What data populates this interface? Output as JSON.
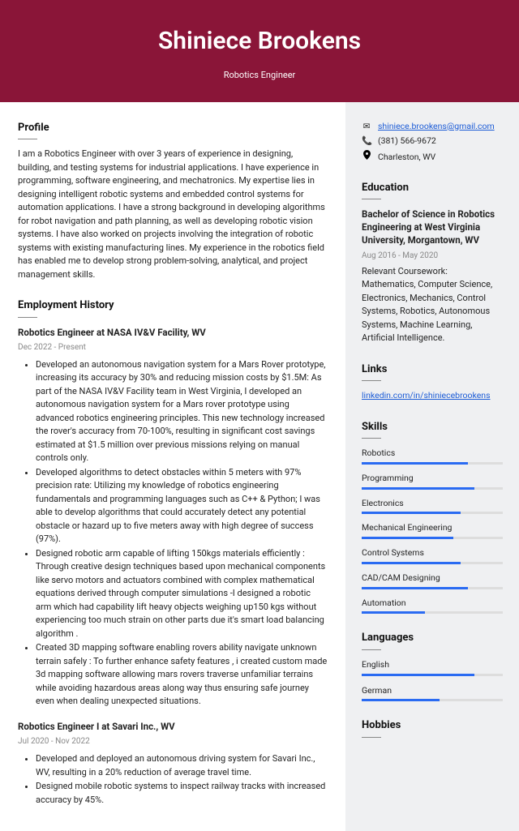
{
  "header": {
    "name": "Shiniece Brookens",
    "title": "Robotics Engineer"
  },
  "sections": {
    "profile": "Profile",
    "employment": "Employment History",
    "education": "Education",
    "links": "Links",
    "skills": "Skills",
    "languages": "Languages",
    "hobbies": "Hobbies"
  },
  "profile_text": "I am a Robotics Engineer with over 3 years of experience in designing, building, and testing systems for industrial applications. I have experience in programming, software engineering, and mechatronics. My expertise lies in designing intelligent robotic systems and embedded control systems for automation applications. I have a strong background in developing algorithms for robot navigation and path planning, as well as developing robotic vision systems. I have also worked on projects involving the integration of robotic systems with existing manufacturing lines. My experience in the robotics field has enabled me to develop strong problem-solving, analytical, and project management skills.",
  "jobs": [
    {
      "title": "Robotics Engineer at NASA IV&V Facility, WV",
      "dates": "Dec 2022 - Present",
      "bullets": [
        "Developed an autonomous navigation system for a Mars Rover prototype, increasing its accuracy by 30% and reducing mission costs by $1.5M: As part of the NASA IV&V Facility team in West Virginia, I developed an autonomous navigation system for a Mars rover prototype using advanced robotics engineering principles. This new technology increased the rover's accuracy from 70-100%, resulting in significant cost savings estimated at $1.5 million over previous missions relying on manual controls only.",
        "Developed algorithms to detect obstacles within 5 meters with 97% precision rate: Utilizing my knowledge of robotics engineering fundamentals and programming languages such as C++ & Python; I was able to develop algorithms that could accurately detect any potential obstacle or hazard up to five meters away with high degree of success (97%).",
        "Designed robotic arm capable of lifting 150kgs materials efficiently : Through creative design techniques based upon mechanical components like servo motors and actuators combined with complex mathematical equations derived through computer simulations -I designed a robotic arm which had capability lift heavy objects weighing up150 kgs without experiencing too much strain on other parts due it's smart load balancing algorithm .",
        "Created 3D mapping software enabling rovers ability navigate unknown terrain safely : To further enhance safety features , i created custom made 3d mapping software allowing mars rovers traverse unfamiliar terrains while avoiding hazardous areas along way thus ensuring safe journey even when dealing unexpected situations."
      ]
    },
    {
      "title": "Robotics Engineer I at Savari Inc., WV",
      "dates": "Jul 2020 - Nov 2022",
      "bullets": [
        "Developed and deployed an autonomous driving system for Savari Inc., WV, resulting in a 20% reduction of average travel time.",
        "Designed mobile robotic systems to inspect railway tracks with increased accuracy by 45%."
      ]
    }
  ],
  "contact": {
    "email": "shiniece.brookens@gmail.com",
    "phone": "(381) 566-9672",
    "location": "Charleston, WV"
  },
  "education": {
    "title": "Bachelor of Science in Robotics Engineering at West Virginia University, Morgantown, WV",
    "dates": "Aug 2016 - May 2020",
    "desc": "Relevant Coursework: Mathematics, Computer Science, Electronics, Mechanics, Control Systems, Robotics, Autonomous Systems, Machine Learning, Artificial Intelligence."
  },
  "links": {
    "link1": "linkedin.com/in/shiniecebrookens"
  },
  "skills": [
    {
      "name": "Robotics",
      "pct": 75
    },
    {
      "name": "Programming",
      "pct": 80
    },
    {
      "name": "Electronics",
      "pct": 70
    },
    {
      "name": "Mechanical Engineering",
      "pct": 65
    },
    {
      "name": "Control Systems",
      "pct": 70
    },
    {
      "name": "CAD/CAM Designing",
      "pct": 75
    },
    {
      "name": "Automation",
      "pct": 45
    }
  ],
  "languages": [
    {
      "name": "English",
      "pct": 80
    },
    {
      "name": "German",
      "pct": 55
    }
  ]
}
